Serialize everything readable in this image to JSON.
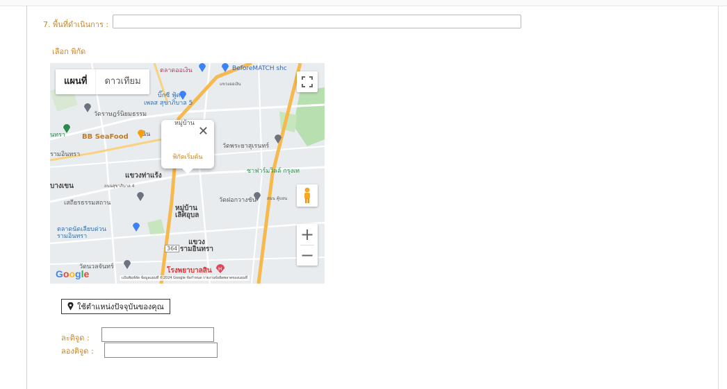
{
  "form": {
    "field7_label": "7. พื้นที่ดำเนินการ :",
    "field7_value": "",
    "pick_location_label": "เลือก พิกัด",
    "use_location_button": "ใช้ตำแหน่งปัจจุบันของคุณ",
    "latitude_label": "ละติจูด :",
    "latitude_value": "",
    "longitude_label": "ลองติจูด :",
    "longitude_value": ""
  },
  "map": {
    "type_options": [
      "แผนที่",
      "ดาวเทียม"
    ],
    "selected_type": "แผนที่",
    "infowindow_text": "พิกัดเริ่มต้น",
    "zoom_in": "+",
    "zoom_out": "−",
    "google_logo": "Google",
    "attribution": "แป้นพิมพ์ลัด  ข้อมูลแผนที่ ©2024 Google  ข้อกำหนด  รายงานข้อผิดพลาดของแผนที่",
    "labels": {
      "market_ooen": "ตลาดออเงิน",
      "beforematch": "BeforeMATCH shc",
      "sukhaphiban5": "เพลส สุขาภิบาล 5",
      "bigc": "บิ๊กซี ฟู้ด",
      "wat_rat": "วัดราษฎร์นิยมธรรม",
      "bb_seafood": "BB SeaFood",
      "khlong_ooen": "แขวงออเงิน",
      "wat_phraya": "วัดพระยาสุเรนทร์",
      "ramintra": "รามอินทรา",
      "tha_raeng": "แขวงท่าแร้ง",
      "bang_khen": "บางเขน",
      "sukhaphiban4": "ถนนสุขาภิบาล 4",
      "sathian": "เสถียรธรรมสถาน",
      "wat_fak": "วัดฝอกวางชัน",
      "moo_baan": "หมู่บ้าน เลิศอุบล",
      "talad_nat": "ตลาดนัดเลียบด่วน รามอินทรา",
      "khwaeng_ram": "แขวง รามอินทรา",
      "wat_nuan": "วัดนวลจันทร์",
      "hospital": "โรงพยาบาลสิน",
      "farmville": "ชาฟาร์มวิลล์ กรุงเท",
      "mooban_top": "หมู่บ้าน",
      "nin": "นิน",
      "road_kubon": "ถนน คู้บอน",
      "nasra": "นทรา",
      "ramin_left": "รามอินทรา",
      "route_364": "364"
    }
  },
  "colors": {
    "label_accent": "#c8872a",
    "map_road": "#f5b94e",
    "map_green": "#b8dfb0",
    "map_base": "#e9ecef"
  }
}
